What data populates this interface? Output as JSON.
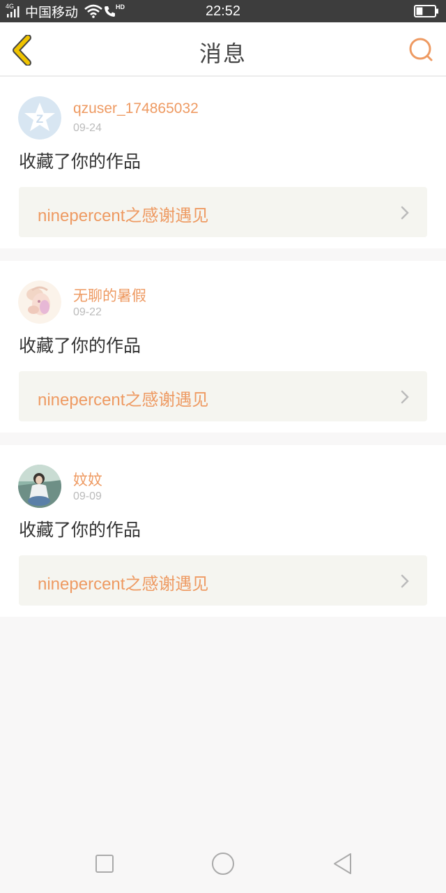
{
  "status_bar": {
    "network_type": "4G",
    "carrier": "中国移动",
    "hd_label": "HD",
    "time": "22:52",
    "battery_level": 0.35
  },
  "header": {
    "title": "消息",
    "back_icon": "chevron-left-icon",
    "search_icon": "search-icon"
  },
  "messages": [
    {
      "username": "qzuser_174865032",
      "date": "09-24",
      "action": "收藏了你的作品",
      "work_title": "ninepercent之感谢遇见",
      "avatar": "qzone-default-avatar"
    },
    {
      "username": "无聊的暑假",
      "date": "09-22",
      "action": "收藏了你的作品",
      "work_title": "ninepercent之感谢遇见",
      "avatar": "anime-girl-avatar"
    },
    {
      "username": "妏妏",
      "date": "09-09",
      "action": "收藏了你的作品",
      "work_title": "ninepercent之感谢遇见",
      "avatar": "photo-avatar"
    }
  ],
  "nav_bar": {
    "items": [
      "recents-square-icon",
      "home-circle-icon",
      "back-triangle-icon"
    ]
  },
  "colors": {
    "accent": "#ee9a62",
    "back_icon": "#f0c400",
    "header_bg": "#ffffff",
    "page_bg": "#f8f7f7",
    "status_bar_bg": "#3d3d3d"
  }
}
